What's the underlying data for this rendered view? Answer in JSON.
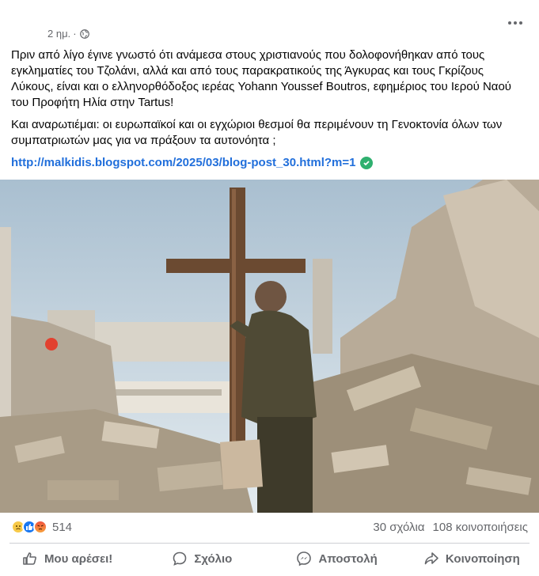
{
  "post": {
    "timestamp": "2 ημ.",
    "separator": "·",
    "paragraph1": "Πριν από λίγο έγινε γνωστό ότι ανάμεσα στους χριστιανούς που δολοφονήθηκαν από τους\nεγκληματίες του Τζολάνι, αλλά και από τους παρακρατικούς της Άγκυρας και  τους Γκρίζους\nΛύκους,  είναι και ο  ελληνορθόδοξος ιερέας Yohann Youssef Boutros,  εφημέριος του Ιερού Ναού\nτου Προφήτη Ηλία στην Tartus!",
    "paragraph2": "Και αναρωτιέμαι: οι ευρωπαϊκοί και οι εγχώριοι θεσμοί θα περιμένουν τη Γενοκτονία όλων των\nσυμπατριωτών μας για να πράξουν τα αυτονόητα ;",
    "link": "http://malkidis.blogspot.com/2025/03/blog-post_30.html?m=1"
  },
  "stats": {
    "reaction_count": "514",
    "comments": "30 σχόλια",
    "shares": "108 κοινοποιήσεις"
  },
  "actions": {
    "like": "Μου αρέσει!",
    "comment": "Σχόλιο",
    "send": "Αποστολή",
    "share": "Κοινοποίηση"
  },
  "icons": {
    "privacy": "globe-icon",
    "more": "more-options-icon",
    "verified": "verified-check-icon",
    "reactions": [
      "sad-reaction-icon",
      "like-reaction-icon",
      "angry-reaction-icon"
    ]
  },
  "colors": {
    "link": "#216fdb",
    "secondary_text": "#65676b",
    "like_blue": "#1877f2",
    "verified_green": "#2fb06f"
  }
}
